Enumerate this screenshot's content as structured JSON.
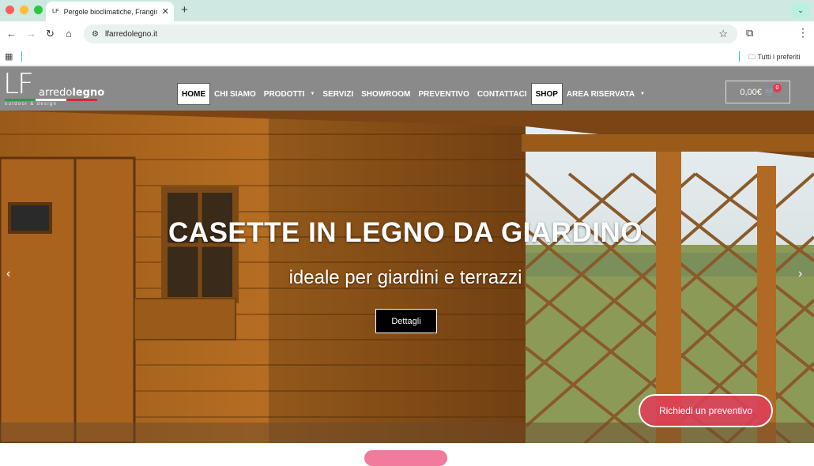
{
  "browser": {
    "tab_title": "Pergole bioclimatiche, Frangisole",
    "tab_favicon": "LF",
    "url": "lfarredolegno.it",
    "bookmarks_folder": "Tutti i preferiti"
  },
  "site": {
    "logo": {
      "big": "LF",
      "word1": "arredo",
      "word2": "legno",
      "tagline": "outdoor & design"
    },
    "menu": [
      {
        "label": "HOME",
        "active": true
      },
      {
        "label": "CHI SIAMO"
      },
      {
        "label": "PRODOTTI",
        "dropdown": true
      },
      {
        "label": "SERVIZI"
      },
      {
        "label": "SHOWROOM"
      },
      {
        "label": "PREVENTIVO"
      },
      {
        "label": "CONTATTACI"
      },
      {
        "label": "SHOP",
        "active": true
      },
      {
        "label": "AREA RISERVATA",
        "dropdown": true
      }
    ],
    "cart": {
      "total": "0,00€",
      "count": "0"
    }
  },
  "hero": {
    "title": "CASETTE IN LEGNO DA GIARDINO",
    "subtitle": "ideale per giardini e terrazzi",
    "button": "Dettagli",
    "prev_arrow": "‹",
    "next_arrow": "›"
  },
  "floating": {
    "quote_button": "Richiedi un preventivo"
  },
  "colors": {
    "header_bg": "#8a8a8a",
    "accent_pink": "#e23c5a",
    "tab_strip": "#cfe8e2"
  },
  "icons": [
    "back-icon",
    "forward-icon",
    "reload-icon",
    "home-icon",
    "site-settings-icon",
    "star-icon",
    "extensions-icon",
    "more-icon",
    "apps-icon",
    "folder-icon",
    "cart-icon",
    "close-icon",
    "plus-icon"
  ]
}
